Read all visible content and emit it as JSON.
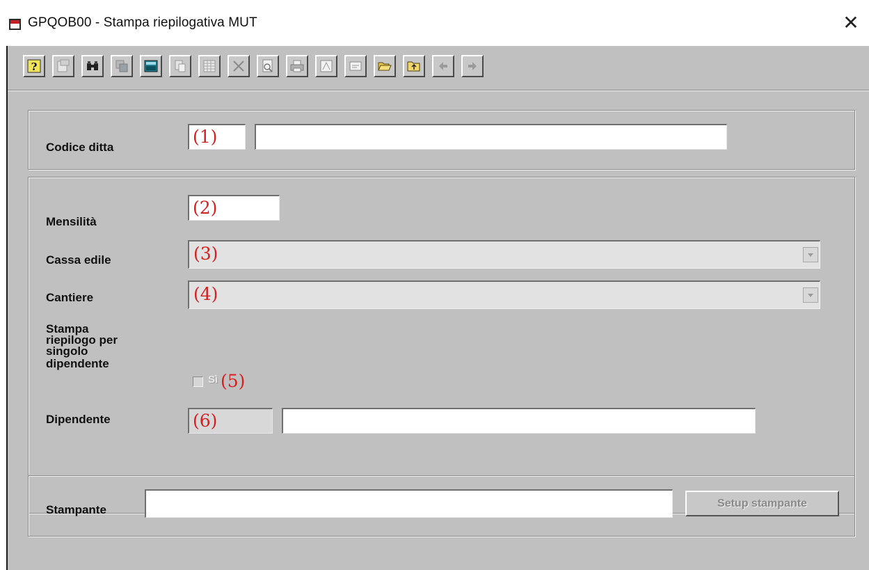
{
  "window": {
    "title": "GPQOB00 - Stampa riepilogativa MUT",
    "close_glyph": "✕"
  },
  "toolbar": {
    "icons": [
      "help-icon",
      "properties-icon",
      "binoculars-icon",
      "copy-icon",
      "calculator-icon",
      "paste-icon",
      "grid-icon",
      "delete-icon",
      "print-preview-icon",
      "printer-icon",
      "document-icon",
      "note-icon",
      "open-folder-icon",
      "folder-up-icon",
      "arrow-left-icon",
      "arrow-right-icon"
    ]
  },
  "company": {
    "label": "Codice ditta",
    "code_marker": "(1)",
    "code_value": "",
    "name_value": ""
  },
  "filters": {
    "mensilita": {
      "label": "Mensilità",
      "marker": "(2)"
    },
    "cassa_edile": {
      "label": "Cassa edile",
      "marker": "(3)"
    },
    "cantiere": {
      "label": "Cantiere",
      "marker": "(4)"
    },
    "stampa_riepilogo": {
      "label_line1": "Stampa",
      "label_line2": "riepilogo per",
      "label_line3": "singolo",
      "label_line4": "dipendente",
      "checkbox_label": "Sì",
      "marker": "(5)",
      "checked": false
    },
    "dipendente": {
      "label": "Dipendente",
      "marker": "(6)"
    }
  },
  "printer": {
    "label": "Stampante",
    "value": "",
    "setup_button": "Setup stampante"
  },
  "colors": {
    "marker": "#d42020",
    "background": "#c0c0c0"
  }
}
